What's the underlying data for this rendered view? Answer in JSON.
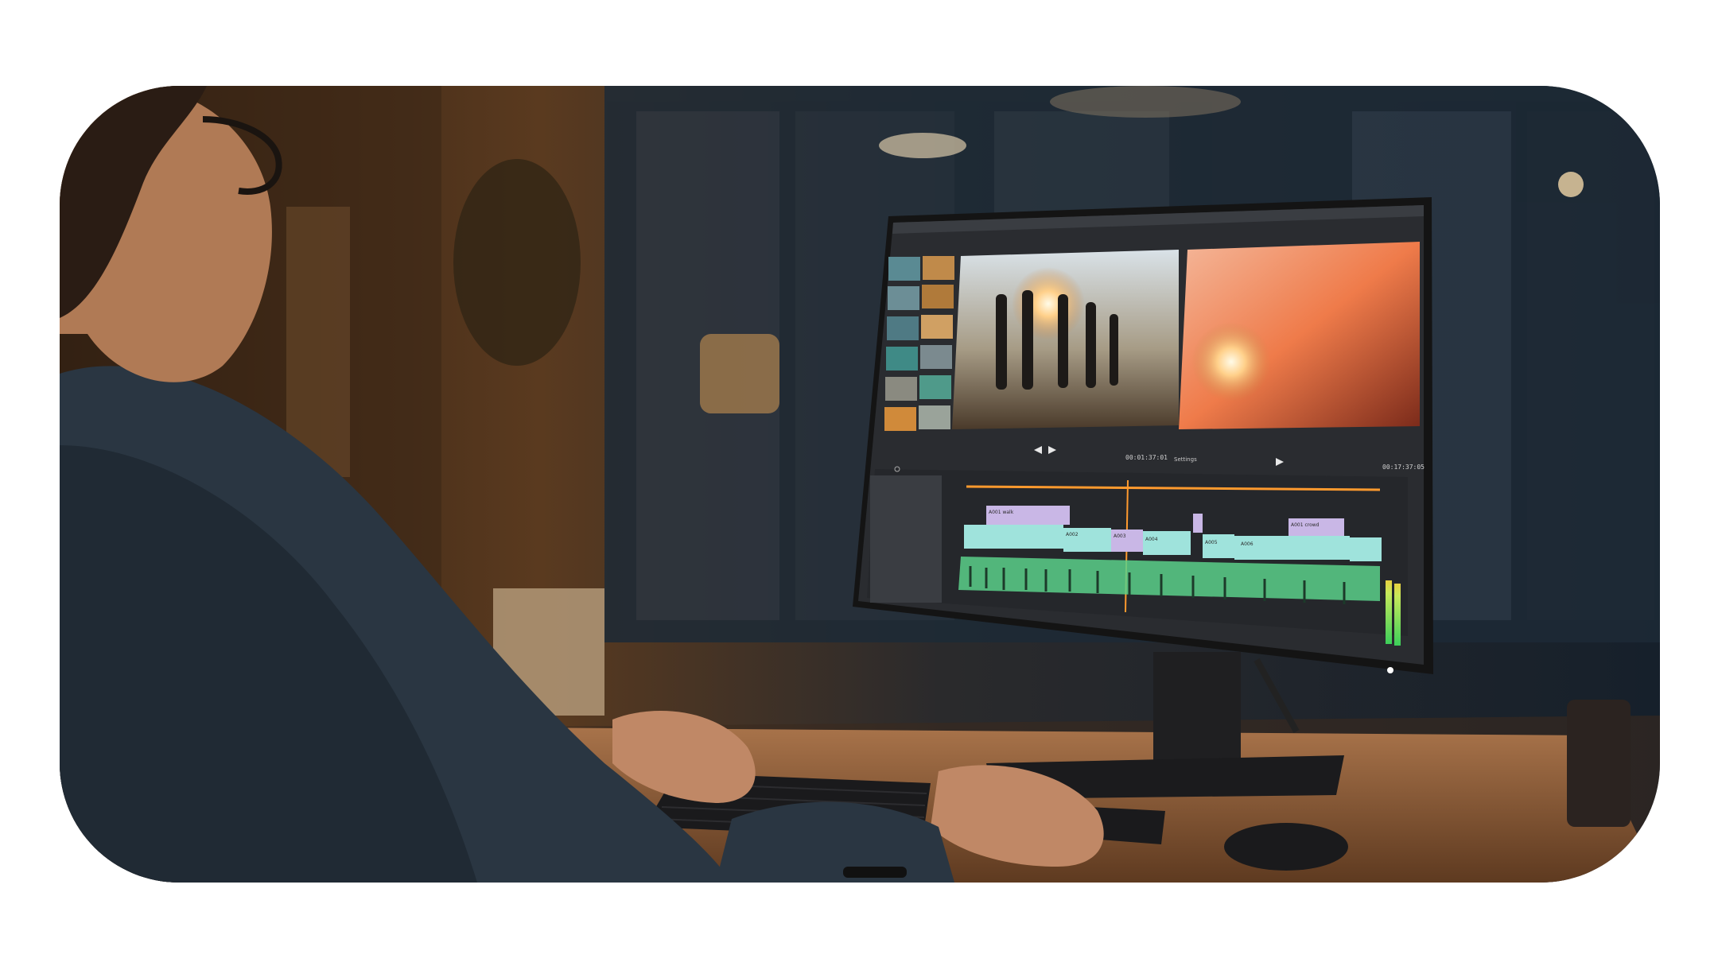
{
  "scene": {
    "description_free": true,
    "frame_shape": "rounded-rectangle",
    "background": "#ffffff",
    "editor": {
      "program_timecode": "00:01:37:01",
      "source_timecode": "00:17:37:05",
      "settings_label": "Settings",
      "clip_labels": [
        "A001 walk",
        "A002",
        "A003",
        "A004",
        "A005",
        "A006",
        "A001 crowd"
      ]
    },
    "colors": {
      "wall_left": "#3a2716",
      "window_night": "#1d2a36",
      "wood_desk": "#8a5a34",
      "monitor_bezel": "#141414",
      "timeline_teal": "#9fe3dc",
      "timeline_lilac": "#c9b7e6",
      "timeline_green": "#5bd08a",
      "playhead": "#ff9a2e",
      "sun_glow": "#ffd08a"
    },
    "icons": [
      "play-icon",
      "rewind-icon",
      "forward-icon",
      "search-icon"
    ]
  }
}
